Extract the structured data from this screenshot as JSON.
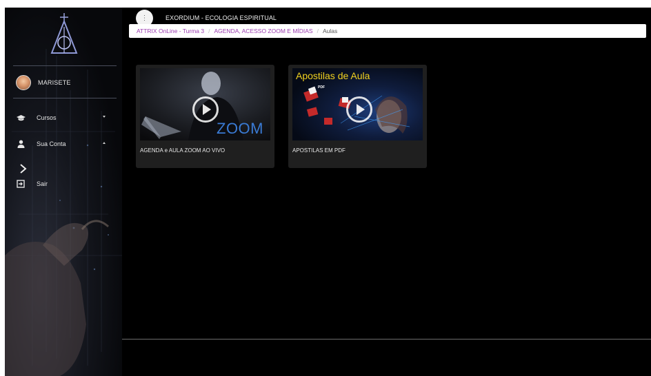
{
  "app": {
    "title": "EXORDIUM - ECOLOGIA ESPIRITUAL",
    "menu_icon": "vertical-dots-icon"
  },
  "breadcrumb": [
    {
      "label": "ATTRIX OnLine - Turma 3",
      "link": true
    },
    {
      "label": "AGENDA, ACESSO ZOOM E MÍDIAS",
      "link": true
    },
    {
      "label": "Aulas",
      "link": false
    }
  ],
  "sidebar": {
    "user": {
      "name": "MARISETE"
    },
    "items": [
      {
        "label": "Cursos",
        "icon": "graduation-cap-icon"
      },
      {
        "label": "Sua Conta",
        "icon": "person-icon"
      },
      {
        "label": "Sair",
        "icon": "logout-icon"
      }
    ]
  },
  "cards": [
    {
      "title": "AGENDA e AULA ZOOM AO VIVO",
      "thumb_text": "ZOOM"
    },
    {
      "title": "APOSTILAS EM PDF",
      "thumb_text": "Apostilas de Aula",
      "badge": "PDF"
    }
  ],
  "colors": {
    "breadcrumb_link": "#9b3cb0",
    "zoom_text": "#3a7bd5",
    "apostilas_text": "#f2d21f"
  }
}
